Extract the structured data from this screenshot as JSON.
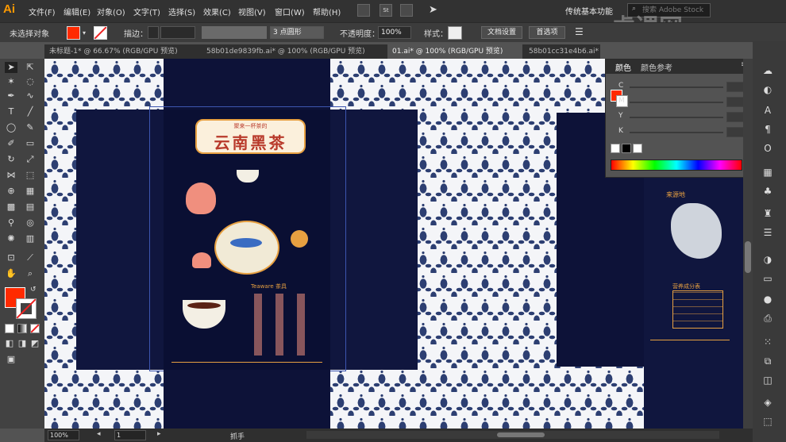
{
  "app": {
    "logo": "Ai",
    "workspace": "传统基本功能",
    "search_placeholder": "搜索 Adobe Stock"
  },
  "menu": [
    "文件(F)",
    "编辑(E)",
    "对象(O)",
    "文字(T)",
    "选择(S)",
    "效果(C)",
    "视图(V)",
    "窗口(W)",
    "帮助(H)"
  ],
  "menubar_icons": [
    "arrange-icon",
    "st-icon",
    "grid-icon",
    "send-icon"
  ],
  "control_bar": {
    "selection_label": "未选择对象",
    "stroke_label": "描边：",
    "brush_label": "3 点圆形",
    "opacity_label": "不透明度：",
    "opacity_value": "100%",
    "style_label": "样式：",
    "doc_setup": "文档设置",
    "preferences": "首选项"
  },
  "tabs": [
    {
      "label": "未标题-1* @ 66.67% (RGB/GPU 预览)",
      "active": false
    },
    {
      "label": "58b01de9839fb.ai* @ 100% (RGB/GPU 预览)",
      "active": false
    },
    {
      "label": "01.ai* @ 100% (RGB/GPU 预览)",
      "active": true
    },
    {
      "label": "58b01cc31e4b6.ai* @ 33.33% (RGB/GPU 预览)",
      "active": false
    }
  ],
  "color_panel": {
    "tab_color": "颜色",
    "tab_color_guide": "颜色参考",
    "channels": [
      "C",
      "M",
      "Y",
      "K"
    ],
    "percent": "%"
  },
  "artwork": {
    "title_small": "聚来一杯茶的",
    "title": "云南黑茶",
    "panel_title": "Teaware 茶具",
    "map_label": "来源地",
    "nutrition_title": "营养成分表"
  },
  "status_bar": {
    "zoom": "100%",
    "artboard": "1",
    "tool_name": "抓手"
  },
  "watermark": "虎课网",
  "colors": {
    "fill": "#ff2a00",
    "navy": "#0d1238",
    "pattern": "#2d3f72",
    "accent": "#e7a041",
    "title_red": "#b8392a"
  }
}
